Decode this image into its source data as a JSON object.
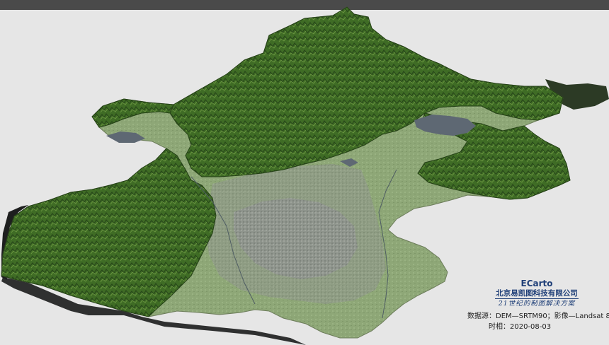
{
  "brand": {
    "name": "ECarto",
    "company": "北京易凯图科技有限公司",
    "slogan": "21世纪的制图解决方案"
  },
  "credits": {
    "source": "数据源：DEM—SRTM90；影像—Landsat 8",
    "date": "时相：2020-08-03"
  },
  "colors": {
    "background": "#e6e6e6",
    "top_bar": "#4a4a4a",
    "mountain_green": "#3d6a24",
    "plain_green": "#8fa578",
    "urban_gray": "#8e938e",
    "water": "#5c6770",
    "shadow": "#2f2f2f",
    "brand_text": "#1f3f78"
  }
}
